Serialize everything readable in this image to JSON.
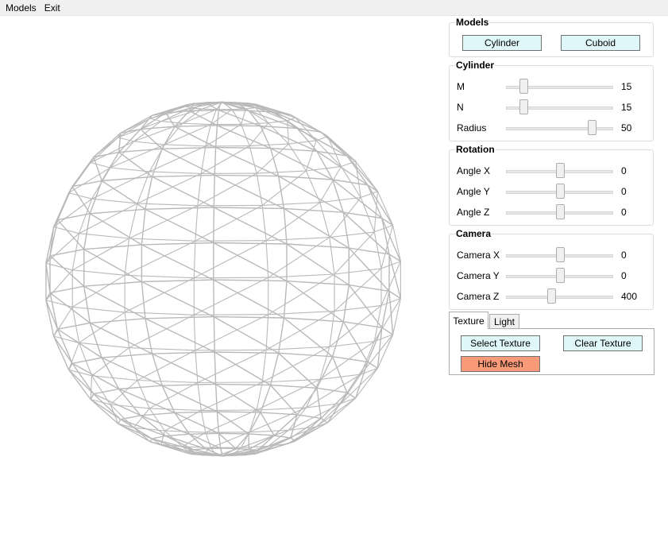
{
  "menu": {
    "models": "Models",
    "exit": "Exit"
  },
  "models_group": {
    "title": "Models",
    "cylinder": "Cylinder",
    "cuboid": "Cuboid"
  },
  "cylinder_group": {
    "title": "Cylinder",
    "sliders": [
      {
        "label": "M",
        "value": "15",
        "fraction": 0.16
      },
      {
        "label": "N",
        "value": "15",
        "fraction": 0.16
      },
      {
        "label": "Radius",
        "value": "50",
        "fraction": 0.8
      }
    ]
  },
  "rotation_group": {
    "title": "Rotation",
    "sliders": [
      {
        "label": "Angle X",
        "value": "0",
        "fraction": 0.5
      },
      {
        "label": "Angle Y",
        "value": "0",
        "fraction": 0.5
      },
      {
        "label": "Angle Z",
        "value": "0",
        "fraction": 0.5
      }
    ]
  },
  "camera_group": {
    "title": "Camera",
    "sliders": [
      {
        "label": "Camera X",
        "value": "0",
        "fraction": 0.5
      },
      {
        "label": "Camera Y",
        "value": "0",
        "fraction": 0.5
      },
      {
        "label": "Camera Z",
        "value": "400",
        "fraction": 0.42
      }
    ]
  },
  "tabs": {
    "texture": "Texture",
    "light": "Light"
  },
  "texture_panel": {
    "select_texture": "Select Texture",
    "clear_texture": "Clear Texture",
    "hide_mesh": "Hide Mesh"
  },
  "colors": {
    "button_bg": "#dff7f8",
    "hide_mesh_bg": "#f99a78",
    "mesh_stroke": "#b9b9b9"
  }
}
